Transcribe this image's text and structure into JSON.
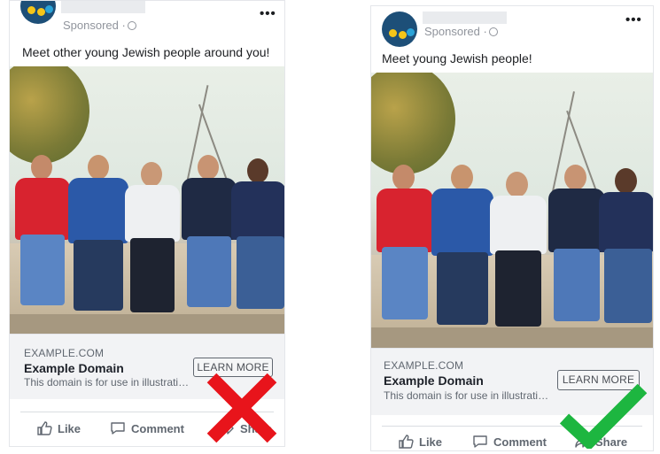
{
  "left_ad": {
    "meta": "Sponsored ·",
    "more": "•••",
    "caption": "Meet other young Jewish people around you!",
    "domain": "EXAMPLE.COM",
    "link_title": "Example Domain",
    "link_desc": "This domain is for use in illustrati…",
    "cta": "LEARN MORE",
    "like": "Like",
    "comment": "Comment",
    "share": "Share",
    "verdict_icon": "red-x-icon"
  },
  "right_ad": {
    "meta": "Sponsored ·",
    "more": "•••",
    "caption": "Meet young Jewish people!",
    "domain": "EXAMPLE.COM",
    "link_title": "Example Domain",
    "link_desc": "This domain is for use in illustrati…",
    "cta": "LEARN MORE",
    "like": "Like",
    "comment": "Comment",
    "share": "Share",
    "verdict_icon": "green-check-icon"
  },
  "colors": {
    "facebook_text": "#1c1e21",
    "muted": "#606770",
    "link_bg": "#f2f3f5",
    "red_x": "#e8141b",
    "green_check": "#1db640"
  }
}
